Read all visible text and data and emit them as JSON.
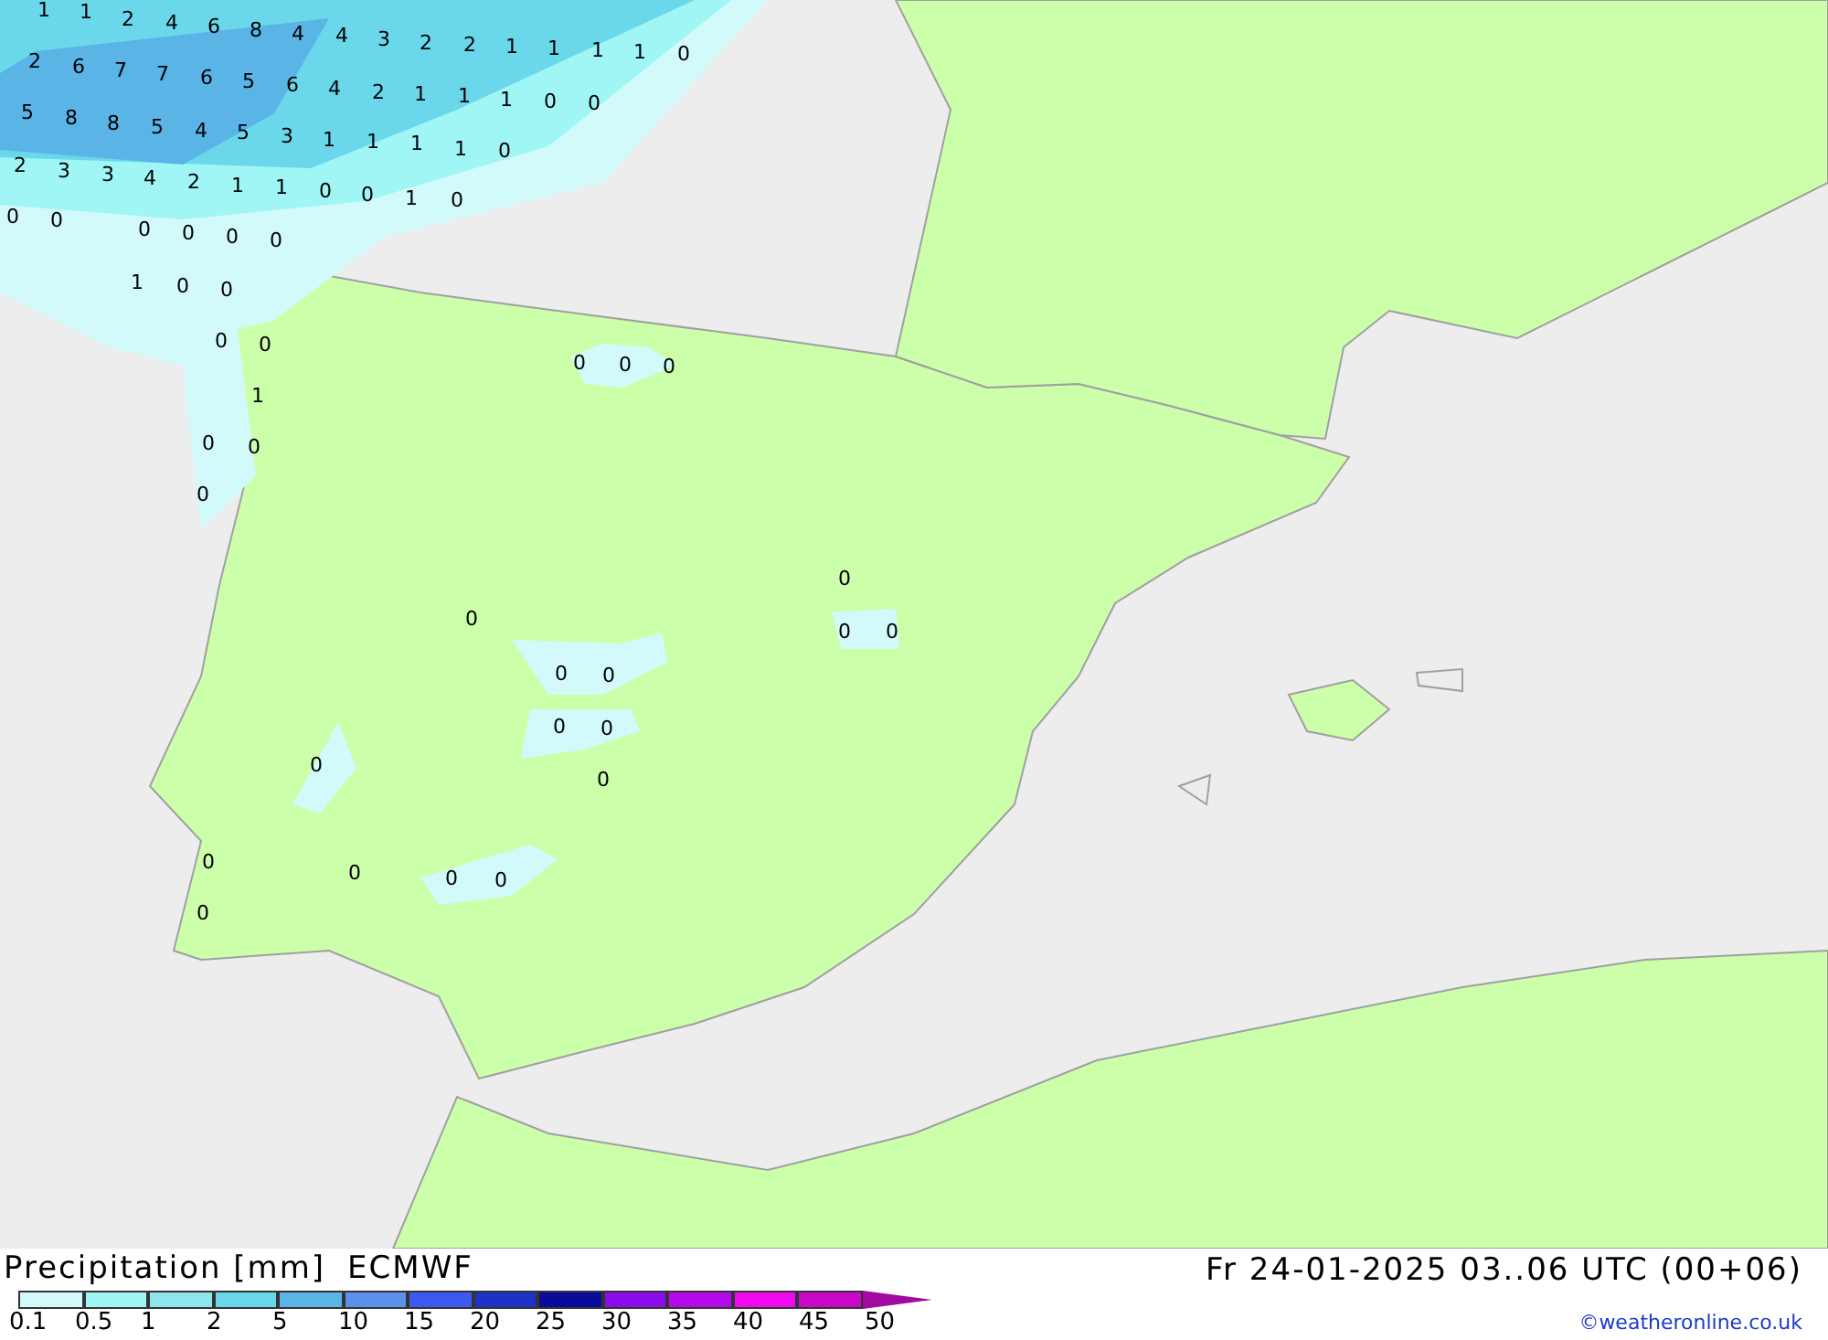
{
  "map_labels": [
    "1",
    "1",
    "2",
    "4",
    "6",
    "8",
    "4",
    "4",
    "3",
    "2",
    "2",
    "1",
    "1",
    "1",
    "1",
    "0",
    "2",
    "6",
    "7",
    "7",
    "6",
    "5",
    "6",
    "4",
    "2",
    "1",
    "1",
    "1",
    "0",
    "0",
    "5",
    "8",
    "8",
    "5",
    "4",
    "5",
    "3",
    "1",
    "1",
    "1",
    "1",
    "0",
    "2",
    "3",
    "3",
    "4",
    "2",
    "1",
    "1",
    "0",
    "0",
    "1",
    "0",
    "0",
    "0",
    "0",
    "0",
    "0",
    "0",
    "1",
    "0",
    "0",
    "0",
    "0",
    "1",
    "0",
    "0",
    "0",
    "0",
    "0",
    "0",
    "0",
    "0",
    "0",
    "0",
    "0",
    "0",
    "0",
    "0",
    "0",
    "0",
    "0",
    "0",
    "0",
    "0",
    "0"
  ],
  "legend": {
    "title": "Precipitation [mm]",
    "model": "ECMWF",
    "bins": [
      {
        "color": "#d2fafa"
      },
      {
        "color": "#a0f5f5"
      },
      {
        "color": "#8ce6eb"
      },
      {
        "color": "#6ad7eb"
      },
      {
        "color": "#5ab4e6"
      },
      {
        "color": "#5a91eb"
      },
      {
        "color": "#3c5af0"
      },
      {
        "color": "#1e32c8"
      },
      {
        "color": "#0a0a9b"
      },
      {
        "color": "#8c0aeb"
      },
      {
        "color": "#b40aeb"
      },
      {
        "color": "#f00af0"
      },
      {
        "color": "#c80ac8"
      }
    ],
    "ticks": [
      "0.1",
      "0.5",
      "1",
      "2",
      "5",
      "10",
      "15",
      "20",
      "25",
      "30",
      "35",
      "40",
      "45",
      "50"
    ]
  },
  "timestamp": "Fr 24-01-2025 03..06 UTC (00+06)",
  "copyright": "©weatheronline.co.uk"
}
